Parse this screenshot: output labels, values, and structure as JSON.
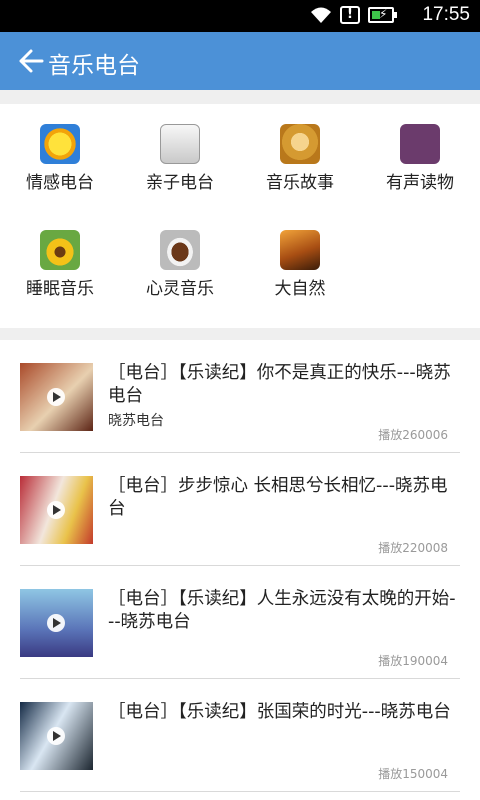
{
  "status_bar": {
    "time": "17:55"
  },
  "header": {
    "title": "音乐电台"
  },
  "categories": [
    {
      "label": "情感电台",
      "icon": "sun-icon"
    },
    {
      "label": "亲子电台",
      "icon": "kid-toy-icon"
    },
    {
      "label": "音乐故事",
      "icon": "headphones-icon"
    },
    {
      "label": "有声读物",
      "icon": "audiobook-icon"
    },
    {
      "label": "睡眠音乐",
      "icon": "sunflower-icon"
    },
    {
      "label": "心灵音乐",
      "icon": "coffee-icon"
    },
    {
      "label": "大自然",
      "icon": "sunset-icon"
    }
  ],
  "list": [
    {
      "title": "［电台］【乐读纪】你不是真正的快乐---晓苏电台",
      "subtitle": "晓苏电台",
      "plays": "播放260006"
    },
    {
      "title": "［电台］步步惊心 长相思兮长相忆---晓苏电台",
      "subtitle": "",
      "plays": "播放220008"
    },
    {
      "title": "［电台］【乐读纪】人生永远没有太晚的开始---晓苏电台",
      "subtitle": "",
      "plays": "播放190004"
    },
    {
      "title": "［电台］【乐读纪】张国荣的时光---晓苏电台",
      "subtitle": "",
      "plays": "播放150004"
    }
  ]
}
